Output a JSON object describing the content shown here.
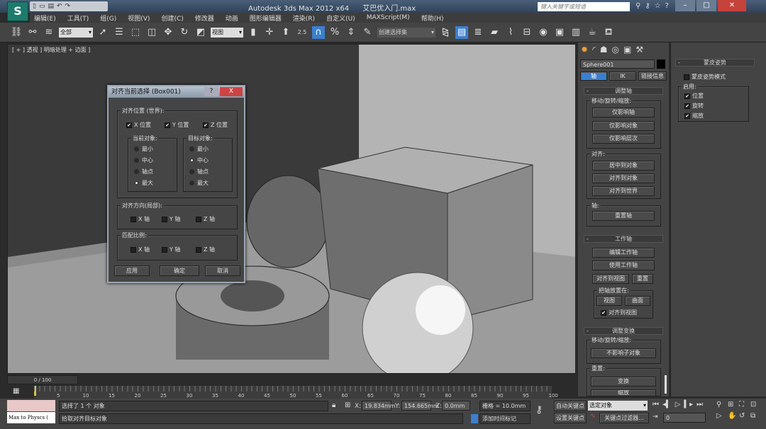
{
  "titlebar": {
    "app": "Autodesk 3ds Max  2012 x64",
    "file": "艾巴优入门.max",
    "search_placeholder": "键入关键字或短语",
    "logo": "S"
  },
  "menu": [
    "编辑(E)",
    "工具(T)",
    "组(G)",
    "视图(V)",
    "创建(C)",
    "修改器",
    "动画",
    "图形编辑器",
    "渲染(R)",
    "自定义(U)",
    "MAXScript(M)",
    "帮助(H)"
  ],
  "toolbar": {
    "filter": "全部",
    "coord": "视图",
    "selset": "创建选择集",
    "snap_label": "2.5"
  },
  "viewport": {
    "label": "[ + ] 透视 ] 明暗处理 + 边面 ]"
  },
  "dialog": {
    "title": "对齐当前选择 (Box001)",
    "help": "?",
    "close": "X",
    "pos_group": "对齐位置 (世界):",
    "xpos": "X 位置",
    "ypos": "Y 位置",
    "zpos": "Z 位置",
    "current": "当前对象:",
    "target": "目标对象:",
    "options": [
      "最小",
      "中心",
      "轴点",
      "最大"
    ],
    "current_selected": "最大",
    "target_selected": "中心",
    "orient_group": "对齐方向(局部):",
    "scale_group": "匹配比例:",
    "x_axis": "X 轴",
    "y_axis": "Y 轴",
    "z_axis": "Z 轴",
    "apply": "应用",
    "ok": "确定",
    "cancel": "取消"
  },
  "command_panel": {
    "object_name": "Sphere001",
    "tabs": [
      "轴",
      "IK",
      "链接信息"
    ],
    "adjust_pivot": "调整轴",
    "move_rotate_scale": "移动/旋转/缩放:",
    "affect_pivot": "仅影响轴",
    "affect_object": "仅影响对象",
    "affect_hierarchy": "仅影响层次",
    "align": "对齐:",
    "center_to_object": "居中到对象",
    "align_to_object": "对齐到对象",
    "align_to_world": "对齐到世界",
    "pivot": "轴:",
    "reset_pivot": "重置轴",
    "working_pivot": "工作轴",
    "edit_working_pivot": "编辑工作轴",
    "use_working_pivot": "使用工作轴",
    "align_to_view": "对齐到视图",
    "reset": "重置",
    "place_pivot_to": "把轴放置在:",
    "view": "视图",
    "surface": "曲面",
    "align_to_view_check": "对齐到视图",
    "adjust_transform": "调整变换",
    "dont_affect_children": "不影响子对象",
    "reset_label": "重置:",
    "transform": "变换",
    "scale": "缩放"
  },
  "skin_pose": {
    "title": "蒙皮姿势",
    "mode": "蒙皮姿势模式",
    "enabled": "启用:",
    "position": "位置",
    "rotation": "旋转",
    "scale": "缩放"
  },
  "timeline": {
    "slider": "0 / 100",
    "ticks": [
      "5",
      "10",
      "15",
      "20",
      "25",
      "30",
      "35",
      "40",
      "45",
      "50",
      "55",
      "60",
      "65",
      "70",
      "75",
      "80",
      "85",
      "90",
      "95",
      "100"
    ]
  },
  "status": {
    "maxscript": "Max to Physcs (",
    "selected": "选择了 1 个 对象",
    "prompt": "拾取对齐目标对象",
    "x_label": "X:",
    "x": "19.834mm",
    "y_label": "Y:",
    "y": "154.665mm",
    "z_label": "Z:",
    "z": "0.0mm",
    "grid": "栅格 = 10.0mm",
    "add_time_tag": "添加时间标记",
    "auto_key": "自动关键点",
    "set_key": "设置关键点",
    "key_mode": "选定对象",
    "key_filters": "关键点过滤器...",
    "frame": "0"
  }
}
